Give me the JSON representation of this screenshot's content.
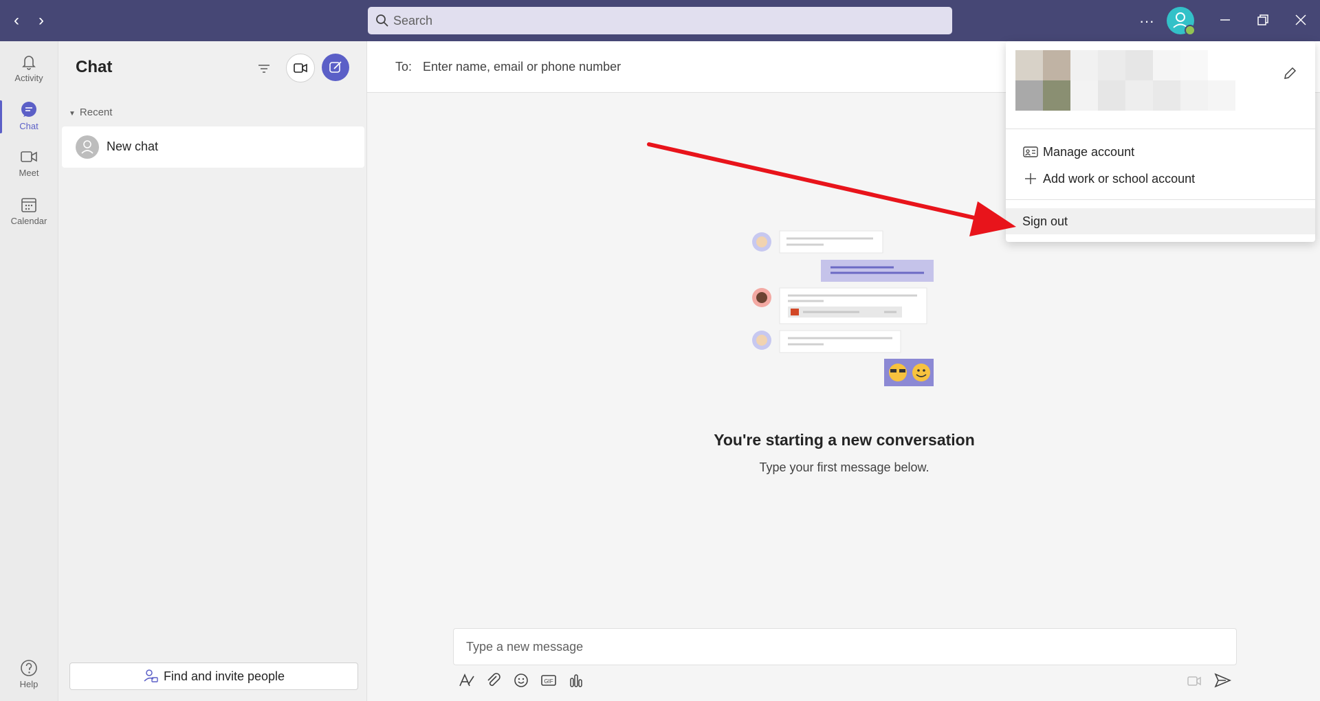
{
  "search": {
    "placeholder": "Search"
  },
  "rail": {
    "items": [
      {
        "label": "Activity"
      },
      {
        "label": "Chat"
      },
      {
        "label": "Meet"
      },
      {
        "label": "Calendar"
      }
    ],
    "help": "Help"
  },
  "chatlist": {
    "title": "Chat",
    "section": "Recent",
    "new_chat": "New chat",
    "find_invite": "Find and invite people"
  },
  "compose": {
    "to_label": "To:",
    "to_placeholder": "Enter name, email or phone number",
    "empty_title": "You're starting a new conversation",
    "empty_subtitle": "Type your first message below.",
    "message_placeholder": "Type a new message"
  },
  "account_menu": {
    "manage": "Manage account",
    "add": "Add work or school account",
    "sign_out": "Sign out"
  },
  "colors": {
    "titlebar": "#464775",
    "accent": "#5b5fc7",
    "avatar": "#33c1c8",
    "arrow": "#e8141b"
  }
}
